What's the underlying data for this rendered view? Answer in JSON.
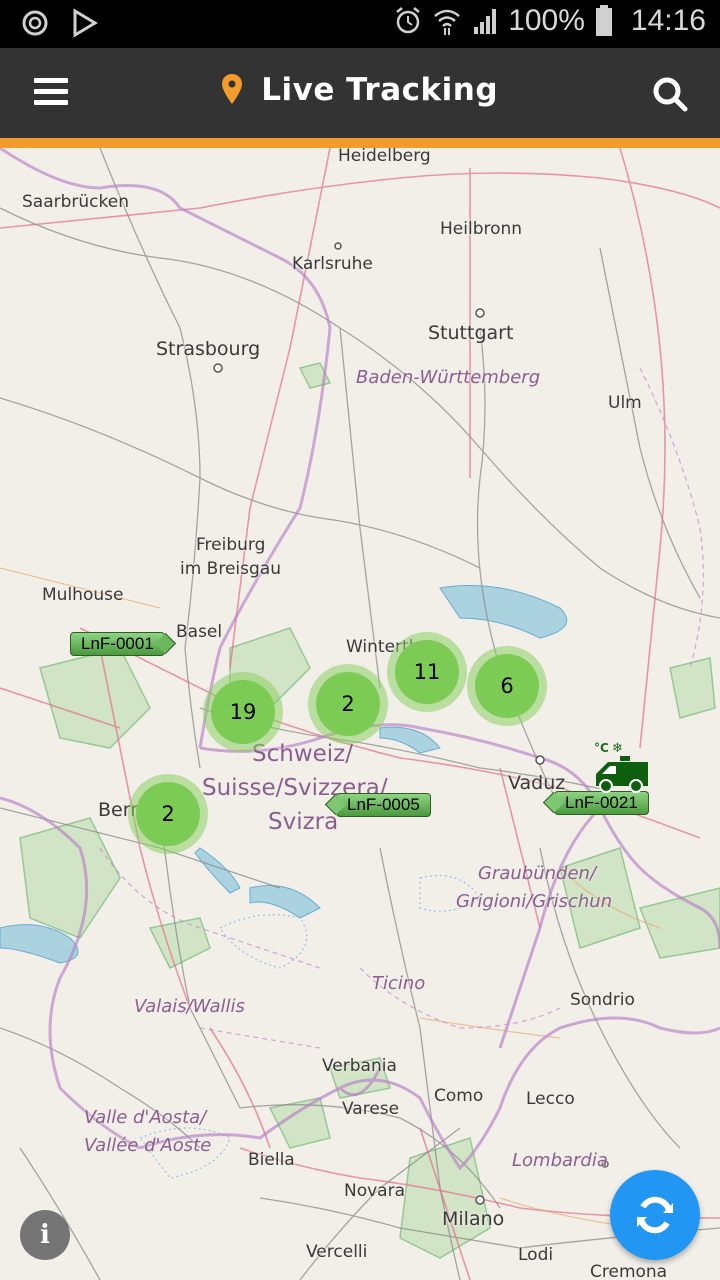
{
  "status_bar": {
    "time": "14:16",
    "battery": "100%",
    "icons": [
      "sync-icon",
      "play-store-icon",
      "alarm-icon",
      "wifi-icon",
      "signal-icon",
      "battery-icon"
    ]
  },
  "app_bar": {
    "title": "Live Tracking",
    "menu_icon": "hamburger-menu-icon",
    "title_icon": "location-pin-icon",
    "search_icon": "search-icon",
    "accent_color": "#f39c2b",
    "background_color": "#333333"
  },
  "map": {
    "places": [
      {
        "name": "Heidelberg"
      },
      {
        "name": "Saarbrücken"
      },
      {
        "name": "Heilbronn"
      },
      {
        "name": "Karlsruhe"
      },
      {
        "name": "Stuttgart"
      },
      {
        "name": "Strasbourg"
      },
      {
        "name": "Ulm"
      },
      {
        "name": "Freiburg"
      },
      {
        "name": "im Breisgau"
      },
      {
        "name": "Mulhouse"
      },
      {
        "name": "Basel"
      },
      {
        "name": "Winterthur"
      },
      {
        "name": "Vaduz"
      },
      {
        "name": "Bern"
      },
      {
        "name": "Sondrio"
      },
      {
        "name": "Verbania"
      },
      {
        "name": "Como"
      },
      {
        "name": "Lecco"
      },
      {
        "name": "Varese"
      },
      {
        "name": "Biella"
      },
      {
        "name": "Novara"
      },
      {
        "name": "Milano"
      },
      {
        "name": "Vercelli"
      },
      {
        "name": "Lodi"
      },
      {
        "name": "Cremona"
      }
    ],
    "regions": [
      {
        "name": "Baden-Württemberg"
      },
      {
        "name": "Schweiz/"
      },
      {
        "name": "Suisse/Svizzera/"
      },
      {
        "name": "Svizra"
      },
      {
        "name": "Graubünden/"
      },
      {
        "name": "Grigioni/Grischun"
      },
      {
        "name": "Ticino"
      },
      {
        "name": "Valais/Wallis"
      },
      {
        "name": "Valle d'Aosta/"
      },
      {
        "name": "Vallée d'Aoste"
      },
      {
        "name": "Lombardia"
      }
    ],
    "clusters": [
      {
        "count": "19"
      },
      {
        "count": "2"
      },
      {
        "count": "11"
      },
      {
        "count": "6"
      },
      {
        "count": "2"
      }
    ],
    "vehicles": [
      {
        "id": "LnF-0001"
      },
      {
        "id": "LnF-0005"
      },
      {
        "id": "LnF-0021",
        "type": "refrigerated-truck",
        "badges": "°C ❄"
      }
    ]
  },
  "fab": {
    "info_label": "i",
    "refresh_icon": "refresh-icon",
    "refresh_color": "#2196f3"
  }
}
